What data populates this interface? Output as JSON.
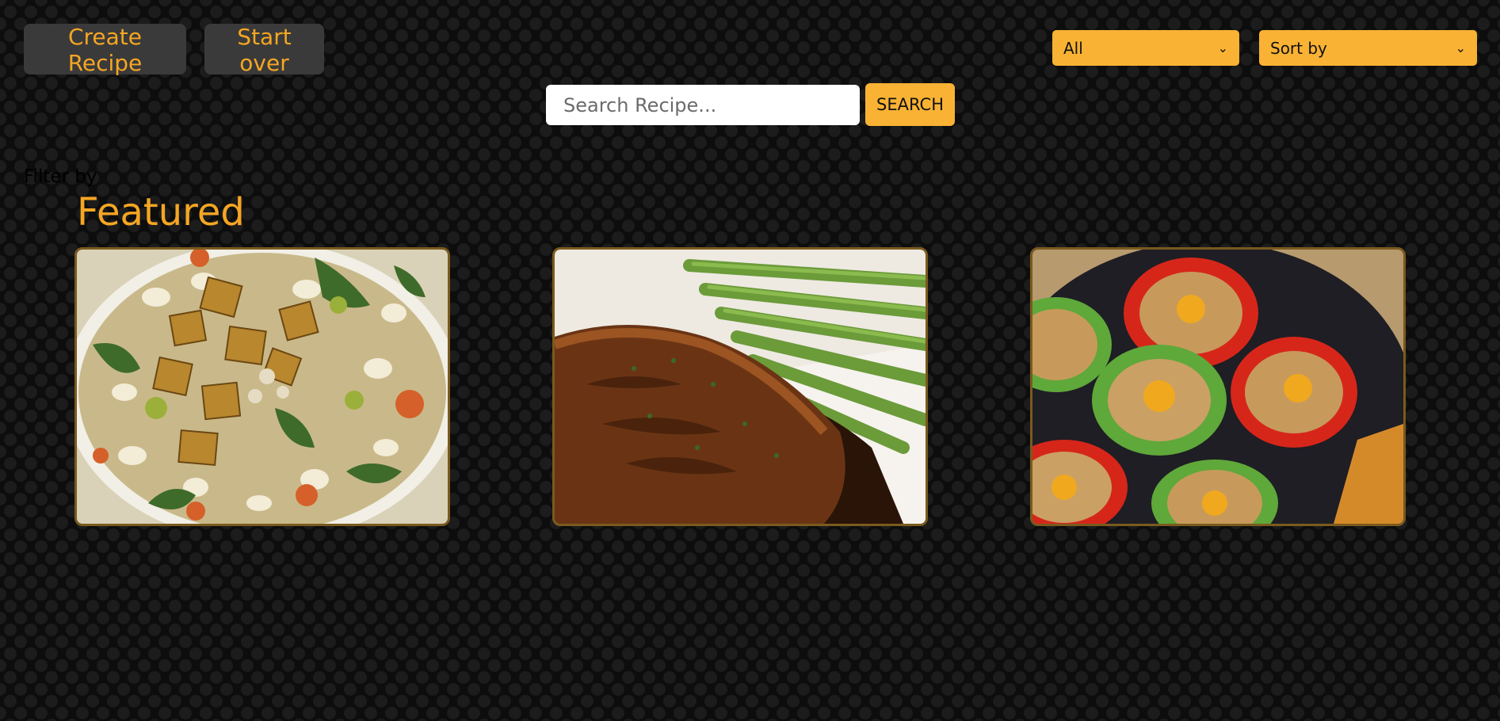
{
  "header": {
    "create_label": "Create Recipe",
    "start_over_label": "Start over"
  },
  "filters": {
    "category_selected": "All",
    "sort_selected": "Sort by"
  },
  "search": {
    "placeholder": "Search Recipe...",
    "button_label": "SEARCH"
  },
  "filter_label": "Filter by",
  "featured": {
    "title": "Featured",
    "cards": [
      {
        "image": "white-bean-soup-photo"
      },
      {
        "image": "glazed-salmon-asparagus-photo"
      },
      {
        "image": "stuffed-peppers-skillet-photo"
      }
    ]
  },
  "colors": {
    "accent": "#f5a623",
    "select_bg": "#f9b233",
    "button_bg": "#3a3a3a",
    "card_border": "#7a5a1e"
  },
  "icons": {
    "dropdown": "chevron-down-icon"
  }
}
